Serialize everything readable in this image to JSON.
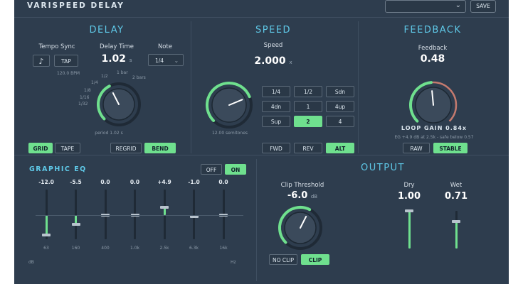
{
  "header": {
    "title": "VARISPEED DELAY",
    "preset_value": "",
    "save_label": "SAVE"
  },
  "delay": {
    "title": "DELAY",
    "tempo_sync_label": "Tempo Sync",
    "tap_label": "TAP",
    "bpm_text": "120.0 BPM",
    "delay_time_label": "Delay Time",
    "delay_time_value": "1.02",
    "delay_time_unit": "s",
    "note_label": "Note",
    "note_value": "1/4",
    "note_ticks": [
      "1/2",
      "1 bar",
      "2 bars",
      "1/4",
      "1/8",
      "1/16",
      "1/32"
    ],
    "period_text": "period 1.02 s",
    "grid_label": "GRID",
    "tape_label": "TAPE",
    "regrid_label": "REGRID",
    "bend_label": "BEND",
    "knob_level": 0.4
  },
  "speed": {
    "title": "SPEED",
    "label": "Speed",
    "value": "2.000",
    "unit": "x",
    "semitones_text": "12.00 semitones",
    "grid": [
      "1/4",
      "1/2",
      "Sdn",
      "4dn",
      "1",
      "4up",
      "Sup",
      "2",
      "4"
    ],
    "active_index": 7,
    "dir_buttons": [
      "FWD",
      "REV",
      "ALT"
    ],
    "dir_active": 2,
    "knob_level": 0.75
  },
  "feedback": {
    "title": "FEEDBACK",
    "label": "Feedback",
    "value": "0.48",
    "loop_gain": "LOOP GAIN 0.84x",
    "info_text": "EG +4.9 dB at 2.5k - safe below 0.57",
    "raw_label": "RAW",
    "stable_label": "STABLE",
    "knob_level": 0.48
  },
  "eq": {
    "title": "GRAPHIC EQ",
    "off_label": "OFF",
    "on_label": "ON",
    "gains": [
      "-12.0",
      "-5.5",
      "0.0",
      "0.0",
      "+4.9",
      "-1.0",
      "0.0"
    ],
    "gain_values": [
      -12.0,
      -5.5,
      0.0,
      0.0,
      4.9,
      -1.0,
      0.0
    ],
    "freqs": [
      "63",
      "160",
      "400",
      "1.0k",
      "2.5k",
      "6.3k",
      "16k"
    ],
    "db_label": "dB",
    "hz_label": "Hz"
  },
  "output": {
    "title": "OUTPUT",
    "clip_label": "Clip Threshold",
    "clip_value": "-6.0",
    "clip_unit": "dB",
    "dry_label": "Dry",
    "dry_value": "1.00",
    "wet_label": "Wet",
    "wet_value": "0.71",
    "noclip_label": "NO CLIP",
    "clip_btn_label": "CLIP",
    "clip_knob_level": 0.6
  },
  "colors": {
    "accent": "#6fe08e",
    "title": "#5fc9e8",
    "panel": "#2e3d4e",
    "feedback_arc": "#c47a6e"
  }
}
